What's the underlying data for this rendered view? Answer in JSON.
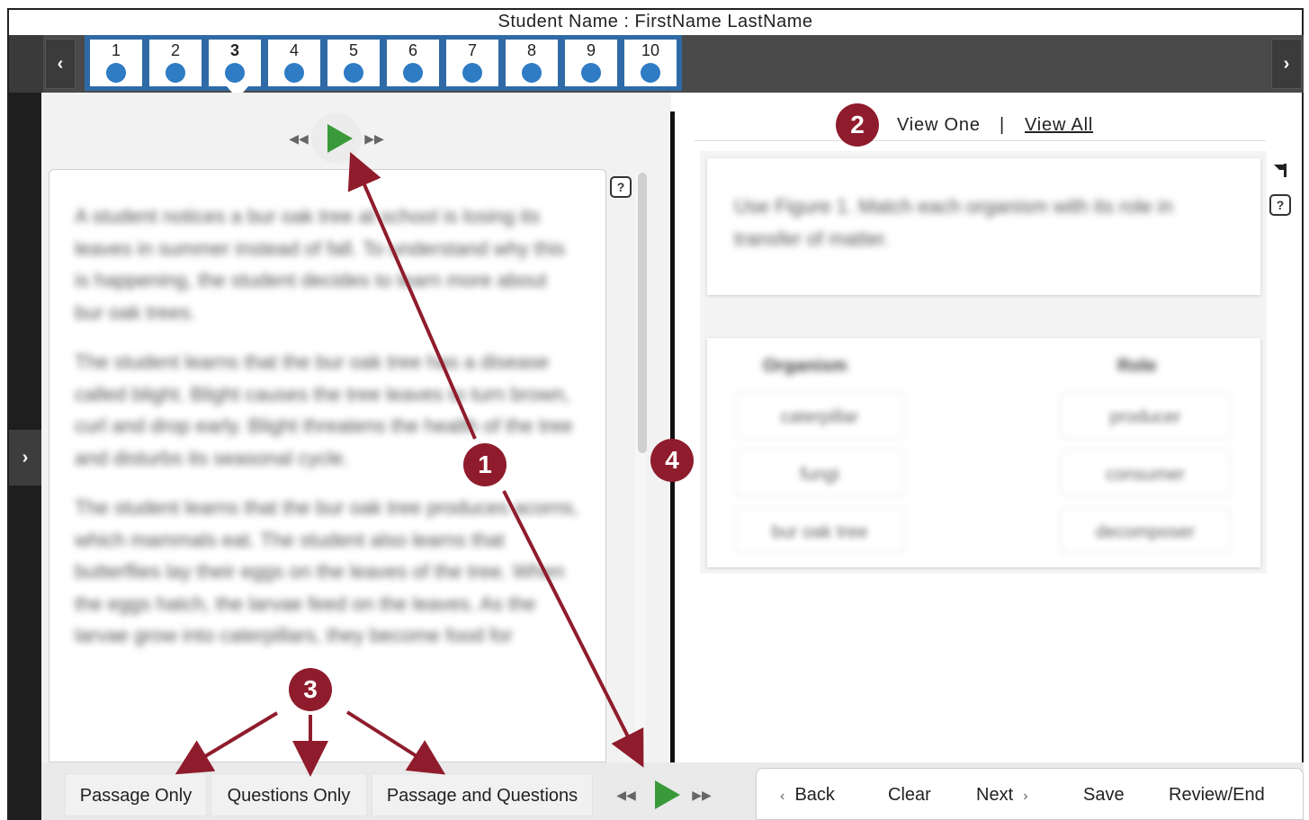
{
  "header": {
    "student_label": "Student Name : FirstName LastName"
  },
  "question_nav": {
    "prev_glyph": "‹",
    "next_glyph": "›",
    "tabs": [
      {
        "label": "1"
      },
      {
        "label": "2"
      },
      {
        "label": "3",
        "active": true
      },
      {
        "label": "4"
      },
      {
        "label": "5"
      },
      {
        "label": "6"
      },
      {
        "label": "7"
      },
      {
        "label": "8"
      },
      {
        "label": "9"
      },
      {
        "label": "10"
      }
    ]
  },
  "left_rail": {
    "expand_glyph": "›"
  },
  "audio": {
    "rewind_glyph": "◀◀",
    "forward_glyph": "▶▶"
  },
  "help_glyph": "?",
  "view_toggle": {
    "view_one": "View One",
    "separator": "|",
    "view_all": "View All"
  },
  "passage": {
    "paragraphs": [
      "A student notices a bur oak tree at school is losing its leaves in summer instead of fall. To understand why this is happening, the student decides to learn more about bur oak trees.",
      "The student learns that the bur oak tree has a disease called blight. Blight causes the tree leaves to turn brown, curl and drop early. Blight threatens the health of the tree and disturbs its seasonal cycle.",
      "The student learns that the bur oak tree produces acorns, which mammals eat. The student also learns that butterflies lay their eggs on the leaves of the tree. When the eggs hatch, the larvae feed on the leaves. As the larvae grow into caterpillars, they become food for"
    ]
  },
  "question": {
    "stem": "Use Figure 1. Match each organism with its role in transfer of matter.",
    "organism_header": "Organism",
    "role_header": "Role",
    "organisms": [
      "caterpillar",
      "fungi",
      "bur oak tree"
    ],
    "roles": [
      "producer",
      "consumer",
      "decomposer"
    ]
  },
  "bottom": {
    "passage_only": "Passage Only",
    "questions_only": "Questions Only",
    "passage_and_questions": "Passage and Questions",
    "back": "Back",
    "clear": "Clear",
    "next": "Next",
    "save": "Save",
    "review_end": "Review/End",
    "back_chevron": "‹",
    "next_chevron": "›"
  },
  "callouts": {
    "c1": "1",
    "c2": "2",
    "c3": "3",
    "c4": "4"
  },
  "colors": {
    "accent_blue": "#2f6aa6",
    "callout_red": "#8f1c2c",
    "arrow_red": "#8f1c2c",
    "play_green": "#3a9a3a"
  }
}
